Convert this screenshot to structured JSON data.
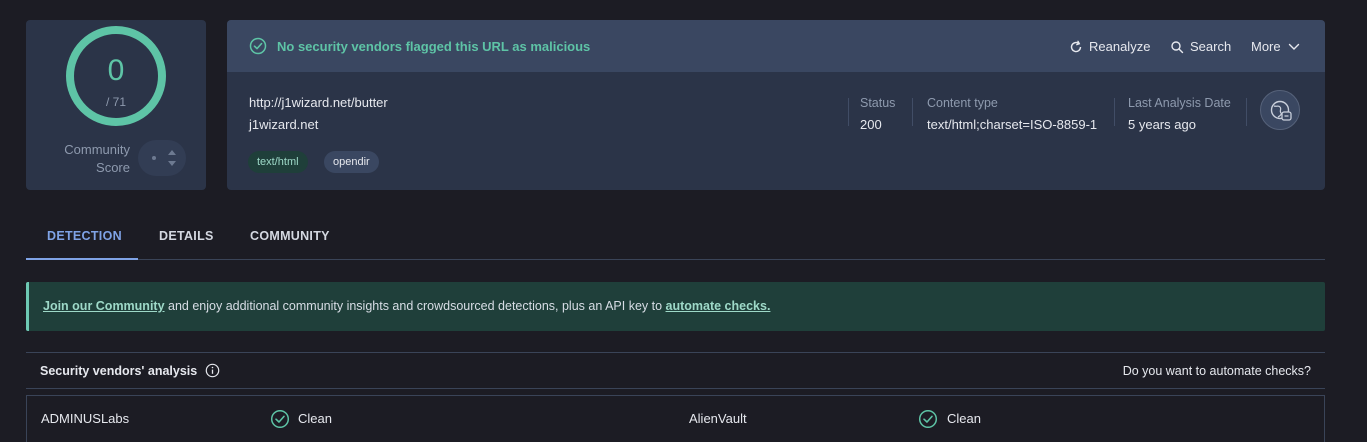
{
  "score": {
    "value": "0",
    "total": "/ 71",
    "community_label_1": "Community",
    "community_label_2": "Score",
    "detected": 0,
    "engines": 71
  },
  "banner": {
    "message": "No security vendors flagged this URL as malicious"
  },
  "actions": {
    "reanalyze": "Reanalyze",
    "search": "Search",
    "more": "More"
  },
  "url": {
    "full": "http://j1wizard.net/butter",
    "domain": "j1wizard.net"
  },
  "tags": [
    "text/html",
    "opendir"
  ],
  "meta": {
    "status_label": "Status",
    "status_value": "200",
    "content_type_label": "Content type",
    "content_type_value": "text/html;charset=ISO-8859-1",
    "last_analysis_label": "Last Analysis Date",
    "last_analysis_value": "5 years ago"
  },
  "tabs": [
    "DETECTION",
    "DETAILS",
    "COMMUNITY"
  ],
  "join": {
    "link1": "Join our Community",
    "middle": " and enjoy additional community insights and crowdsourced detections, plus an API key to ",
    "link2": "automate checks."
  },
  "vendors": {
    "title": "Security vendors' analysis",
    "automate_prompt": "Do you want to automate checks?",
    "rows": [
      {
        "left_name": "ADMINUSLabs",
        "left_status": "Clean",
        "right_name": "AlienVault",
        "right_status": "Clean"
      }
    ]
  },
  "colors": {
    "accent_green": "#5ec4a6",
    "tab_active": "#7fa3e6",
    "panel": "#2b3448",
    "banner": "#3a4761"
  }
}
